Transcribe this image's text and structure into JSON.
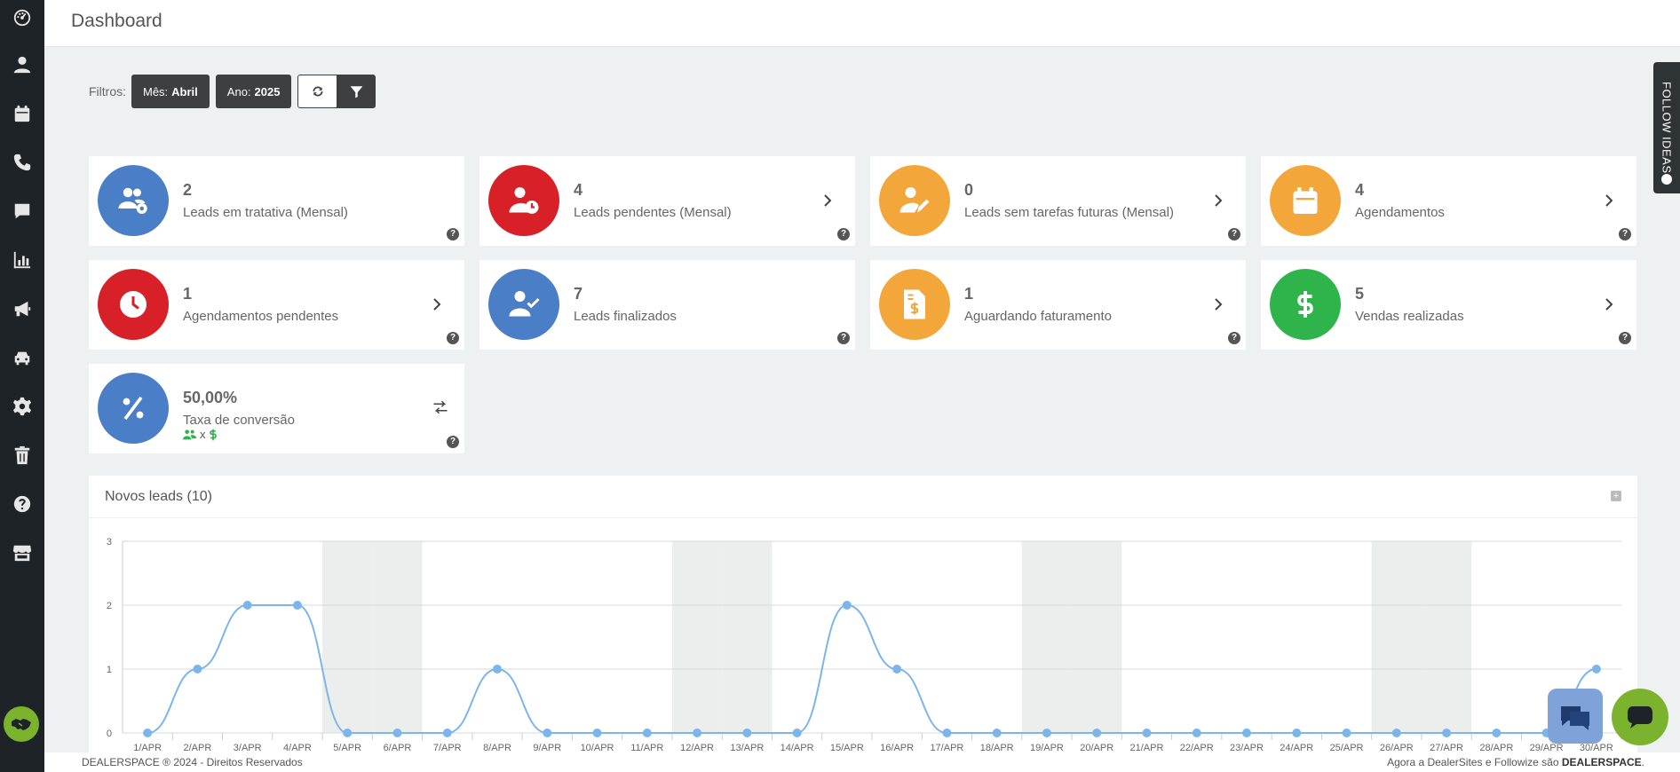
{
  "page": {
    "title": "Dashboard"
  },
  "filters": {
    "label": "Filtros:",
    "month_key": "Mês:",
    "month_value": "Abril",
    "year_key": "Ano:",
    "year_value": "2025"
  },
  "cards": [
    {
      "value": "2",
      "label": "Leads em tratativa (Mensal)",
      "color": "#4a7fc8",
      "icon": "users-cog-icon"
    },
    {
      "value": "4",
      "label": "Leads pendentes (Mensal)",
      "color": "#d72027",
      "icon": "user-clock-icon"
    },
    {
      "value": "0",
      "label": "Leads sem tarefas futuras (Mensal)",
      "color": "#f3a73b",
      "icon": "user-edit-icon"
    },
    {
      "value": "4",
      "label": "Agendamentos",
      "color": "#f3a73b",
      "icon": "calendar-icon"
    },
    {
      "value": "1",
      "label": "Agendamentos pendentes",
      "color": "#d72027",
      "icon": "clock-icon"
    },
    {
      "value": "7",
      "label": "Leads finalizados",
      "color": "#4a7fc8",
      "icon": "user-check-icon"
    },
    {
      "value": "1",
      "label": "Aguardando faturamento",
      "color": "#f3a73b",
      "icon": "invoice-dollar-icon"
    },
    {
      "value": "5",
      "label": "Vendas realizadas",
      "color": "#2fb44b",
      "icon": "dollar-icon"
    },
    {
      "value": "50,00%",
      "label": "Taxa de conversão",
      "color": "#4a7fc8",
      "icon": "percent-icon",
      "sub": "x"
    }
  ],
  "help_glyph": "?",
  "chart_data": {
    "type": "line",
    "title": "Novos leads (10)",
    "categories": [
      "1/APR",
      "2/APR",
      "3/APR",
      "4/APR",
      "5/APR",
      "6/APR",
      "7/APR",
      "8/APR",
      "9/APR",
      "10/APR",
      "11/APR",
      "12/APR",
      "13/APR",
      "14/APR",
      "15/APR",
      "16/APR",
      "17/APR",
      "18/APR",
      "19/APR",
      "20/APR",
      "21/APR",
      "22/APR",
      "23/APR",
      "24/APR",
      "25/APR",
      "26/APR",
      "27/APR",
      "28/APR",
      "29/APR",
      "30/APR"
    ],
    "values": [
      0,
      1,
      2,
      2,
      0,
      0,
      0,
      1,
      0,
      0,
      0,
      0,
      0,
      0,
      2,
      1,
      0,
      0,
      0,
      0,
      0,
      0,
      0,
      0,
      0,
      0,
      0,
      0,
      0,
      1
    ],
    "ylim": [
      0,
      3
    ],
    "yticks": [
      "0",
      "1",
      "2",
      "3"
    ],
    "shaded_categories": [
      "5/APR",
      "6/APR",
      "12/APR",
      "13/APR",
      "19/APR",
      "20/APR",
      "26/APR",
      "27/APR"
    ],
    "line_color": "#7cb5ec",
    "grid": true
  },
  "footer": {
    "left": "DEALERSPACE ® 2024 - Direitos Reservados",
    "right_prefix": "Agora a DealerSites e Followize são ",
    "right_brand": "DEALERSPACE",
    "right_suffix": "."
  },
  "follow_tab": {
    "label": "FOLLOW IDEAS"
  }
}
